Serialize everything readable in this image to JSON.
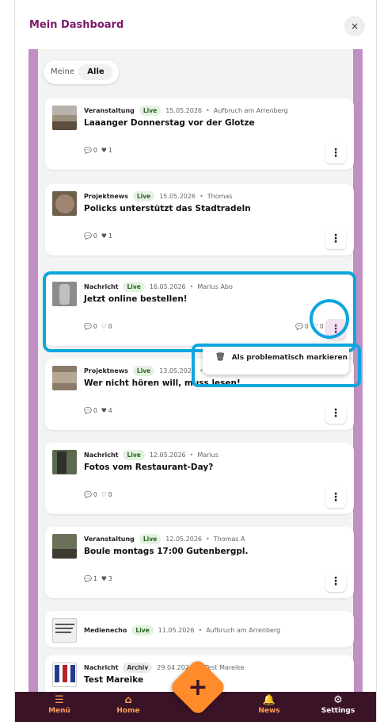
{
  "header": {
    "title": "Mein Dashboard",
    "close": "×"
  },
  "toggle": {
    "meine": "Meine",
    "alle": "Alle"
  },
  "cards": [
    {
      "type": "Veranstaltung",
      "status": "Live",
      "date": "15.05.2026",
      "author": "Aufbruch am Arrenberg",
      "title": "Laaanger Donnerstag vor der Glotze",
      "comments": "0",
      "likes": "1"
    },
    {
      "type": "Projektnews",
      "status": "Live",
      "date": "15.05.2026",
      "author": "Thomas",
      "title": "Policks unterstützt das Stadtradeln",
      "comments": "0",
      "likes": "1"
    },
    {
      "type": "Nachricht",
      "status": "Live",
      "date": "16.05.2026",
      "author": "Marius Abo",
      "title": "Jetzt online bestellen!",
      "comments": "0",
      "likes": "0",
      "comments2": "0",
      "likes2": "0"
    },
    {
      "type": "Projektnews",
      "status": "Live",
      "date": "13.05.2026",
      "author": "",
      "title": "Wer nicht hören will, muss lesen!",
      "comments": "0",
      "likes": "4"
    },
    {
      "type": "Nachricht",
      "status": "Live",
      "date": "12.05.2026",
      "author": "Marius",
      "title": "Fotos vom Restaurant-Day?",
      "comments": "0",
      "likes": "0"
    },
    {
      "type": "Veranstaltung",
      "status": "Live",
      "date": "12.05.2026",
      "author": "Thomas A",
      "title": "Boule montags 17:00 Gutenbergpl.",
      "comments": "1",
      "likes": "3"
    },
    {
      "type": "Medienecho",
      "status": "Live",
      "date": "11.05.2026",
      "author": "Aufbruch am Arrenberg",
      "title": "",
      "comments": "",
      "likes": ""
    },
    {
      "type": "Nachricht",
      "status": "Archiv",
      "date": "29.04.2026",
      "author": "Test Mareike",
      "title": "Test Mareike",
      "comments": "",
      "likes": ""
    }
  ],
  "popup": {
    "label": "Als problematisch markieren"
  },
  "nav": {
    "menu": "Menü",
    "home": "Home",
    "news": "News",
    "settings": "Settings"
  },
  "colors": {
    "accent": "#7a1a6a",
    "nav_bg": "#3a1327",
    "fab": "#ff8b2b",
    "highlight": "#0da6df"
  }
}
